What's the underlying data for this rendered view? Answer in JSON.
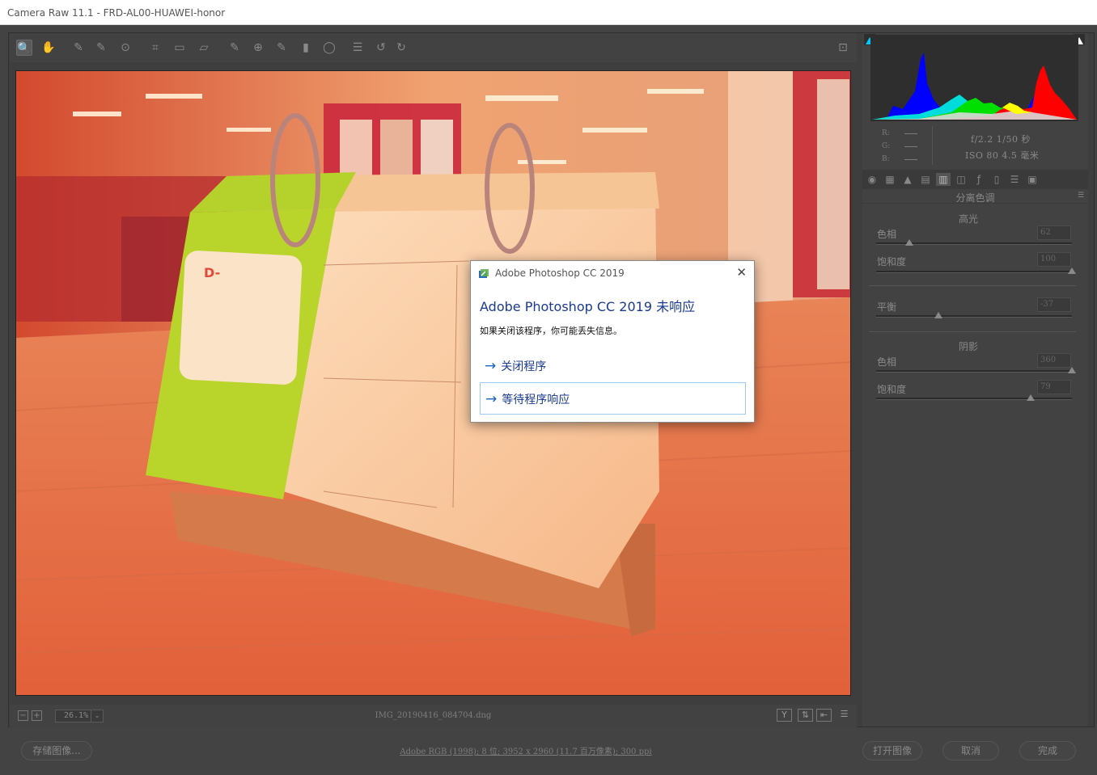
{
  "window": {
    "title": "Camera Raw 11.1 -  FRD-AL00-HUAWEI-honor"
  },
  "toolbar": {
    "tools": [
      {
        "name": "zoom-tool-icon",
        "glyph": "🔍"
      },
      {
        "name": "hand-tool-icon",
        "glyph": "✋"
      },
      {
        "name": "white-balance-tool-icon",
        "glyph": "✎"
      },
      {
        "name": "color-sampler-tool-icon",
        "glyph": "✎"
      },
      {
        "name": "targeted-adjustment-tool-icon",
        "glyph": "⊙"
      },
      {
        "name": "crop-tool-icon",
        "glyph": "⌗"
      },
      {
        "name": "straighten-tool-icon",
        "glyph": "▭"
      },
      {
        "name": "transform-tool-icon",
        "glyph": "▱"
      },
      {
        "name": "spot-removal-tool-icon",
        "glyph": "✎"
      },
      {
        "name": "red-eye-removal-tool-icon",
        "glyph": "⊕"
      },
      {
        "name": "adjustment-brush-icon",
        "glyph": "✎"
      },
      {
        "name": "graduated-filter-icon",
        "glyph": "▮"
      },
      {
        "name": "radial-filter-icon",
        "glyph": "◯"
      },
      {
        "name": "preferences-icon",
        "glyph": "☰"
      },
      {
        "name": "rotate-ccw-icon",
        "glyph": "↺"
      },
      {
        "name": "rotate-cw-icon",
        "glyph": "↻"
      }
    ],
    "fullscreen_icon": "⊡"
  },
  "preview": {
    "zoom": "26.1%",
    "filename": "IMG_20190416_084704.dng"
  },
  "histogram": {
    "rgb_labels": [
      "R:",
      "G:",
      "B:"
    ],
    "camera_line1": "f/2.2   1/50 秒",
    "camera_line2": "ISO 80   4.5 毫米"
  },
  "panel": {
    "title": "分离色调",
    "highlights_title": "高光",
    "shadows_title": "阴影",
    "sliders": [
      {
        "label": "色相",
        "value": "62",
        "position": 0.17
      },
      {
        "label": "饱和度",
        "value": "100",
        "position": 1.0
      },
      {
        "label": "平衡",
        "value": "-37",
        "position": 0.32
      },
      {
        "label": "色相",
        "value": "360",
        "position": 1.0
      },
      {
        "label": "饱和度",
        "value": "79",
        "position": 0.79
      }
    ]
  },
  "buttons": {
    "save": "存储图像...",
    "open": "打开图像",
    "cancel": "取消",
    "done": "完成"
  },
  "workflow_options": "Adobe RGB (1998); 8 位; 3952 x 2960 (11.7 百万像素); 300 ppi",
  "not_responding": {
    "title": "Adobe Photoshop CC 2019",
    "heading": "Adobe Photoshop CC 2019 未响应",
    "message": "如果关闭该程序，你可能丢失信息。",
    "option_close": "关闭程序",
    "option_wait": "等待程序响应",
    "close_glyph": "✕",
    "arrow_glyph": "→"
  },
  "colors": {
    "dialog_heading": "#1a3a8f",
    "option_border": "#9ccaf0",
    "panel_bg": "#424242"
  }
}
